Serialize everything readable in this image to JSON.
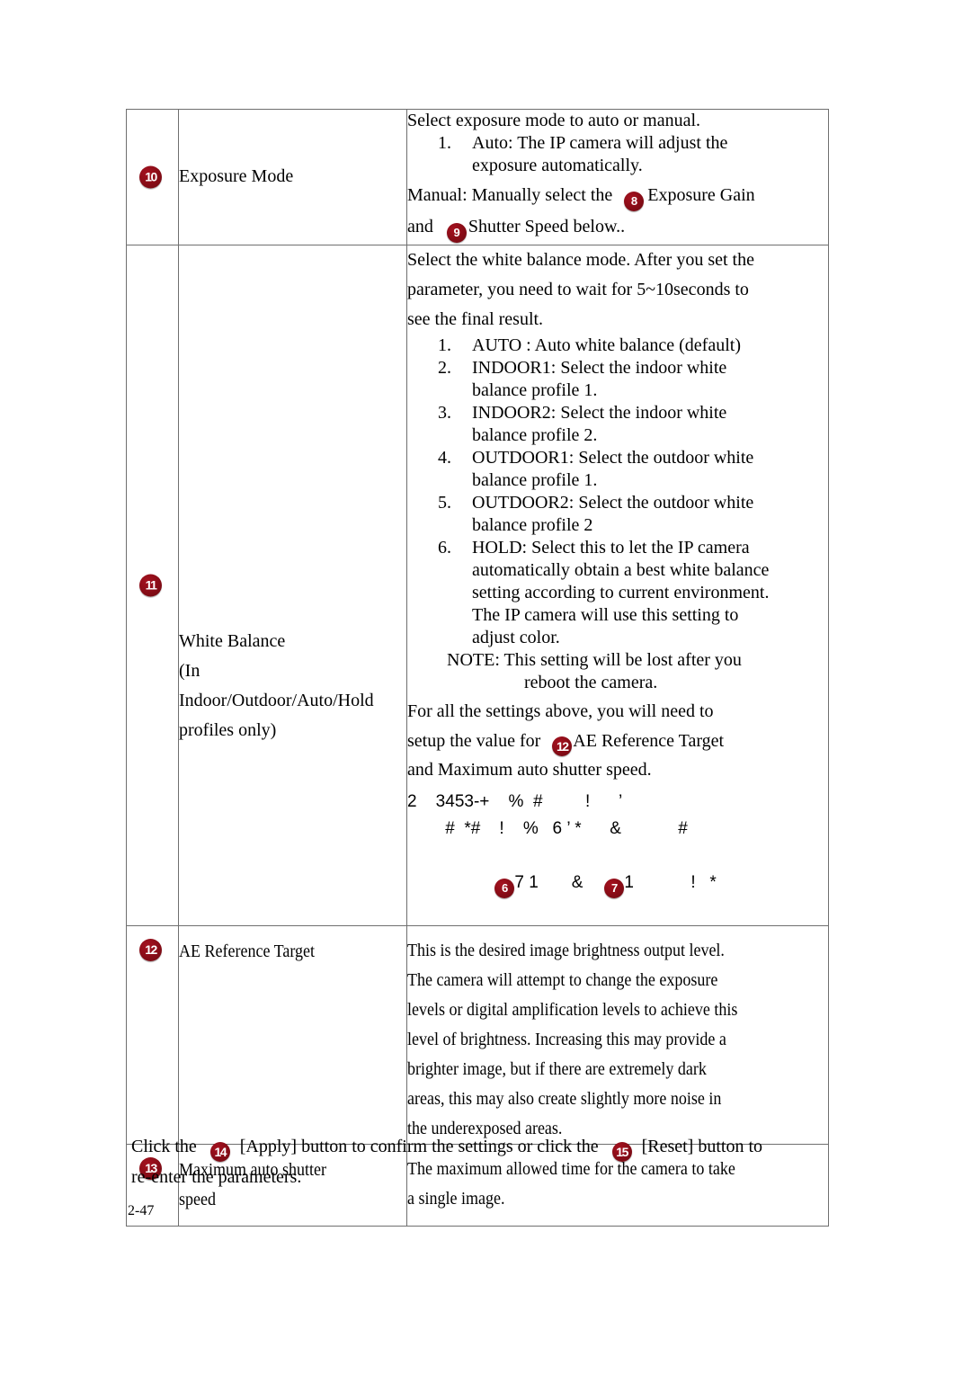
{
  "document": {
    "page_number": "2-47"
  },
  "table": {
    "rows": [
      {
        "badge": "10",
        "name": "Exposure Mode",
        "desc": {
          "intro": "Select exposure mode to auto or manual.",
          "items": [
            {
              "num": "1.",
              "lines": [
                "Auto: The IP camera will adjust the",
                "exposure automatically."
              ]
            }
          ],
          "manual_pre": "Manual:  Manually  select  the",
          "manual_badge": "8",
          "manual_mid": "Exposure  Gain",
          "manual_and": "and",
          "manual_badge2": "9",
          "manual_post": "Shutter Speed below.."
        }
      },
      {
        "badge": "11",
        "name_lines": [
          "White Balance",
          "(In",
          "Indoor/Outdoor/Auto/Hold",
          "profiles only)"
        ],
        "desc": {
          "intro_lines": [
            "Select the white balance mode. After you set the",
            "parameter, you need to wait for 5~10seconds to",
            "see the final result."
          ],
          "items": [
            {
              "num": "1.",
              "lines": [
                "AUTO : Auto white balance (default)"
              ]
            },
            {
              "num": "2.",
              "lines": [
                "INDOOR1: Select the indoor white",
                "balance profile 1."
              ]
            },
            {
              "num": "3.",
              "lines": [
                "INDOOR2: Select the indoor white",
                "balance profile 2."
              ]
            },
            {
              "num": "4.",
              "lines": [
                "OUTDOOR1: Select the outdoor white",
                "balance profile 1."
              ]
            },
            {
              "num": "5.",
              "lines": [
                "OUTDOOR2: Select the outdoor white",
                "balance profile 2"
              ]
            },
            {
              "num": "6.",
              "lines": [
                "HOLD: Select this to let the IP camera",
                "automatically obtain a best white balance",
                "setting according to current environment.",
                "The IP camera will use this setting to",
                "adjust color."
              ]
            }
          ],
          "note_lines": [
            "NOTE: This setting will be lost after you",
            "reboot the camera."
          ],
          "tail_line1": "For all the settings above, you will need to",
          "tail_line2_pre": "setup the value for",
          "tail_badge": "12",
          "tail_line2_post": "AE Reference Target",
          "tail_line3": "and Maximum auto shutter speed.",
          "garbled_line1": "2    3453-+    %  #         !      ’",
          "garbled_line2": "        #  *#    !    %   6 ’ *      &            #",
          "garbled_badge_a": "6",
          "garbled_line3_a": "7 1       &",
          "garbled_badge_b": "7",
          "garbled_line3_b": "1            !   *"
        }
      },
      {
        "badge": "12",
        "name": "AE Reference Target",
        "desc_lines": [
          "This is the desired image brightness output level.",
          "The camera will attempt to change the exposure",
          "levels or digital amplification levels to achieve this",
          "level of brightness. Increasing this may provide a",
          "brighter image, but if there are extremely dark",
          "areas, this may also create slightly more noise in",
          "the underexposed areas."
        ]
      },
      {
        "badge": "13",
        "name_lines": [
          "Maximum auto shutter",
          "speed"
        ],
        "desc_lines": [
          "The maximum allowed time for the camera to take",
          "a single image."
        ]
      }
    ]
  },
  "closing": {
    "pre": "Click the",
    "badge_apply": "14",
    "mid1": "[Apply] button to confirm the settings or click the",
    "badge_reset": "15",
    "mid2": "[Reset] button to",
    "line2": "re-enter the parameters."
  },
  "colors": {
    "badge_red": "#8d0d18",
    "border_gray": "#6f6f6f",
    "text": "#000000"
  }
}
